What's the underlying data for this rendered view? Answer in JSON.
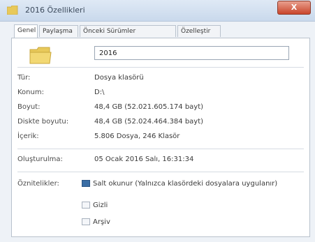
{
  "window": {
    "title": "2016 Özellikleri",
    "close_label": "X"
  },
  "tabs": [
    {
      "label": "Genel",
      "active": true
    },
    {
      "label": "Paylaşma",
      "active": false
    },
    {
      "label": "Önceki Sürümler",
      "active": false
    },
    {
      "label": "Özelleştir",
      "active": false
    }
  ],
  "general": {
    "name_value": "2016",
    "rows": [
      {
        "label": "Tür:",
        "value": "Dosya klasörü"
      },
      {
        "label": "Konum:",
        "value": "D:\\"
      },
      {
        "label": "Boyut:",
        "value": "48,4 GB (52.021.605.174 bayt)"
      },
      {
        "label": "Diskte boyutu:",
        "value": "48,4 GB (52.024.464.384 bayt)"
      },
      {
        "label": "İçerik:",
        "value": "5.806 Dosya, 246 Klasör"
      }
    ],
    "created_label": "Oluşturulma:",
    "created_value": "05 Ocak 2016 Salı, 16:31:34",
    "attributes_label": "Öznitelikler:",
    "readonly_label": "Salt okunur (Yalnızca klasördeki dosyalara uygulanır)",
    "hidden_label": "Gizli",
    "archive_label": "Arşiv"
  },
  "colors": {
    "titlebar": "#c9d9ec",
    "close": "#c9462c",
    "folder": "#e8c95a",
    "checked": "#3a6ea5"
  }
}
